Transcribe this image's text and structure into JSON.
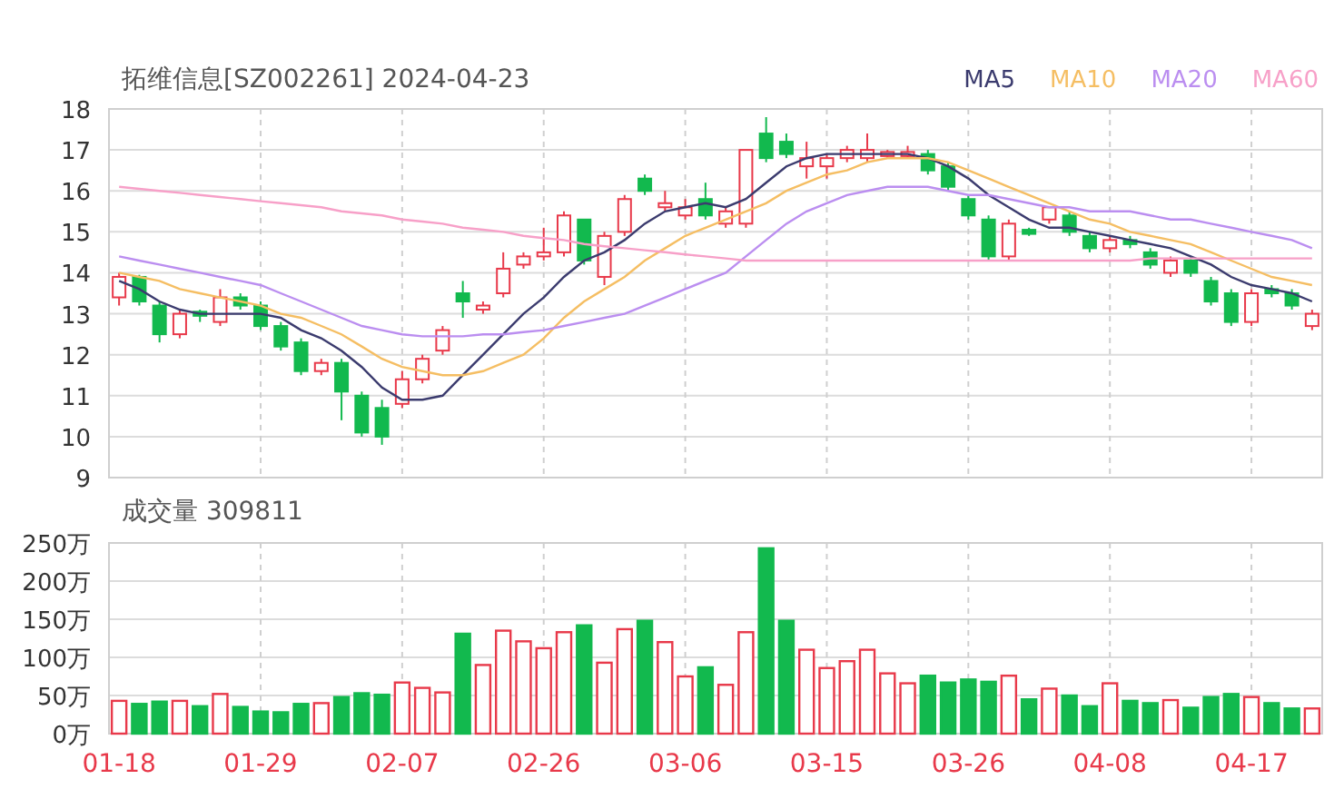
{
  "price": {
    "chart_data": {
      "type": "candlestick",
      "title": "拓维信息[SZ002261] 2024-04-23",
      "grid": true,
      "ylim": [
        9,
        18
      ],
      "yticks": [
        9,
        10,
        11,
        12,
        13,
        14,
        15,
        16,
        17,
        18
      ],
      "ohlc": [
        [
          13.4,
          14.0,
          13.2,
          13.9
        ],
        [
          13.9,
          13.95,
          13.2,
          13.3
        ],
        [
          13.2,
          13.3,
          12.3,
          12.5
        ],
        [
          12.5,
          13.1,
          12.4,
          13.0
        ],
        [
          13.05,
          13.1,
          12.8,
          12.95
        ],
        [
          12.8,
          13.6,
          12.7,
          13.4
        ],
        [
          13.4,
          13.5,
          13.1,
          13.2
        ],
        [
          13.2,
          13.3,
          12.6,
          12.7
        ],
        [
          12.7,
          12.8,
          12.1,
          12.2
        ],
        [
          12.3,
          12.4,
          11.5,
          11.6
        ],
        [
          11.6,
          11.9,
          11.5,
          11.8
        ],
        [
          11.8,
          11.9,
          10.4,
          11.1
        ],
        [
          11.0,
          11.1,
          10.0,
          10.1
        ],
        [
          10.7,
          10.9,
          9.8,
          10.0
        ],
        [
          10.8,
          11.6,
          10.7,
          11.4
        ],
        [
          11.4,
          12.0,
          11.3,
          11.9
        ],
        [
          12.1,
          12.7,
          12.0,
          12.6
        ],
        [
          13.5,
          13.8,
          12.9,
          13.3
        ],
        [
          13.1,
          13.3,
          13.0,
          13.2
        ],
        [
          13.5,
          14.5,
          13.4,
          14.1
        ],
        [
          14.2,
          14.5,
          14.1,
          14.4
        ],
        [
          14.4,
          15.1,
          14.3,
          14.5
        ],
        [
          14.5,
          15.5,
          14.4,
          15.4
        ],
        [
          15.3,
          15.3,
          14.2,
          14.3
        ],
        [
          13.9,
          15.0,
          13.7,
          14.9
        ],
        [
          15.0,
          15.9,
          14.9,
          15.8
        ],
        [
          16.3,
          16.4,
          15.9,
          16.0
        ],
        [
          15.6,
          16.0,
          15.5,
          15.7
        ],
        [
          15.4,
          15.8,
          15.3,
          15.6
        ],
        [
          15.8,
          16.2,
          15.3,
          15.4
        ],
        [
          15.2,
          15.6,
          15.1,
          15.5
        ],
        [
          15.2,
          17.0,
          15.1,
          17.0
        ],
        [
          17.4,
          17.8,
          16.7,
          16.8
        ],
        [
          17.2,
          17.4,
          16.8,
          16.9
        ],
        [
          16.6,
          17.2,
          16.3,
          16.8
        ],
        [
          16.6,
          16.9,
          16.3,
          16.8
        ],
        [
          16.8,
          17.1,
          16.7,
          17.0
        ],
        [
          16.8,
          17.4,
          16.7,
          17.0
        ],
        [
          16.85,
          17.0,
          16.8,
          16.95
        ],
        [
          16.85,
          17.1,
          16.8,
          16.95
        ],
        [
          16.9,
          17.0,
          16.4,
          16.5
        ],
        [
          16.6,
          16.7,
          16.0,
          16.1
        ],
        [
          15.8,
          15.9,
          15.3,
          15.4
        ],
        [
          15.3,
          15.4,
          14.3,
          14.4
        ],
        [
          14.4,
          15.3,
          14.3,
          15.2
        ],
        [
          15.05,
          15.1,
          14.9,
          14.95
        ],
        [
          15.3,
          15.6,
          15.2,
          15.6
        ],
        [
          15.4,
          15.5,
          14.9,
          15.0
        ],
        [
          14.9,
          15.0,
          14.5,
          14.6
        ],
        [
          14.6,
          14.9,
          14.5,
          14.8
        ],
        [
          14.8,
          14.9,
          14.6,
          14.7
        ],
        [
          14.5,
          14.6,
          14.1,
          14.2
        ],
        [
          14.0,
          14.4,
          13.9,
          14.3
        ],
        [
          14.3,
          14.4,
          13.9,
          14.0
        ],
        [
          13.8,
          13.9,
          13.2,
          13.3
        ],
        [
          13.5,
          13.6,
          12.7,
          12.8
        ],
        [
          12.8,
          13.6,
          12.7,
          13.5
        ],
        [
          13.6,
          13.7,
          13.4,
          13.5
        ],
        [
          13.5,
          13.6,
          13.1,
          13.2
        ],
        [
          12.7,
          13.1,
          12.6,
          13.0
        ]
      ]
    }
  },
  "moving_averages": {
    "chart_data": {
      "type": "line",
      "ylim": [
        9,
        18
      ],
      "series": [
        {
          "name": "MA5",
          "color": "#3b3b6e",
          "values": [
            13.8,
            13.6,
            13.3,
            13.1,
            13.0,
            13.0,
            13.0,
            13.0,
            12.9,
            12.6,
            12.4,
            12.1,
            11.7,
            11.2,
            10.9,
            10.9,
            11.0,
            11.5,
            12.0,
            12.5,
            13.0,
            13.4,
            13.9,
            14.3,
            14.5,
            14.8,
            15.2,
            15.5,
            15.6,
            15.7,
            15.6,
            15.8,
            16.2,
            16.6,
            16.8,
            16.9,
            16.9,
            16.9,
            16.9,
            16.9,
            16.8,
            16.6,
            16.3,
            15.9,
            15.6,
            15.3,
            15.1,
            15.1,
            15.0,
            14.9,
            14.8,
            14.7,
            14.6,
            14.4,
            14.2,
            13.9,
            13.7,
            13.6,
            13.5,
            13.3
          ]
        },
        {
          "name": "MA10",
          "color": "#f5be63",
          "values": [
            14.0,
            13.9,
            13.8,
            13.6,
            13.5,
            13.4,
            13.3,
            13.2,
            13.0,
            12.9,
            12.7,
            12.5,
            12.2,
            11.9,
            11.7,
            11.6,
            11.5,
            11.5,
            11.6,
            11.8,
            12.0,
            12.4,
            12.9,
            13.3,
            13.6,
            13.9,
            14.3,
            14.6,
            14.9,
            15.1,
            15.3,
            15.5,
            15.7,
            16.0,
            16.2,
            16.4,
            16.5,
            16.7,
            16.8,
            16.8,
            16.8,
            16.7,
            16.5,
            16.3,
            16.1,
            15.9,
            15.7,
            15.5,
            15.3,
            15.2,
            15.0,
            14.9,
            14.8,
            14.7,
            14.5,
            14.3,
            14.1,
            13.9,
            13.8,
            13.7
          ]
        },
        {
          "name": "MA20",
          "color": "#bb8ef0",
          "values": [
            14.4,
            14.3,
            14.2,
            14.1,
            14.0,
            13.9,
            13.8,
            13.7,
            13.5,
            13.3,
            13.1,
            12.9,
            12.7,
            12.6,
            12.5,
            12.45,
            12.45,
            12.45,
            12.5,
            12.5,
            12.55,
            12.6,
            12.7,
            12.8,
            12.9,
            13.0,
            13.2,
            13.4,
            13.6,
            13.8,
            14.0,
            14.4,
            14.8,
            15.2,
            15.5,
            15.7,
            15.9,
            16.0,
            16.1,
            16.1,
            16.1,
            16.0,
            15.9,
            15.9,
            15.8,
            15.7,
            15.6,
            15.6,
            15.5,
            15.5,
            15.5,
            15.4,
            15.3,
            15.3,
            15.2,
            15.1,
            15.0,
            14.9,
            14.8,
            14.6
          ]
        },
        {
          "name": "MA60",
          "color": "#f7a0c8",
          "values": [
            16.1,
            16.05,
            16.0,
            15.95,
            15.9,
            15.85,
            15.8,
            15.75,
            15.7,
            15.65,
            15.6,
            15.5,
            15.45,
            15.4,
            15.3,
            15.25,
            15.2,
            15.1,
            15.05,
            15.0,
            14.9,
            14.85,
            14.8,
            14.7,
            14.65,
            14.6,
            14.55,
            14.5,
            14.45,
            14.4,
            14.35,
            14.3,
            14.3,
            14.3,
            14.3,
            14.3,
            14.3,
            14.3,
            14.3,
            14.3,
            14.3,
            14.3,
            14.3,
            14.3,
            14.3,
            14.3,
            14.3,
            14.3,
            14.3,
            14.3,
            14.3,
            14.35,
            14.35,
            14.35,
            14.35,
            14.35,
            14.35,
            14.35,
            14.35,
            14.35
          ]
        }
      ]
    }
  },
  "volume": {
    "chart_data": {
      "type": "bar",
      "title": "成交量 309811",
      "grid": true,
      "ylim": [
        0,
        250
      ],
      "yticks": [
        {
          "value": 0,
          "label": "0万"
        },
        {
          "value": 50,
          "label": "50万"
        },
        {
          "value": 100,
          "label": "100万"
        },
        {
          "value": 150,
          "label": "150万"
        },
        {
          "value": 200,
          "label": "200万"
        },
        {
          "value": 250,
          "label": "250万"
        }
      ],
      "categories": [
        "01-18",
        null,
        null,
        null,
        null,
        null,
        null,
        "01-29",
        null,
        null,
        null,
        null,
        null,
        null,
        "02-07",
        null,
        null,
        null,
        null,
        null,
        null,
        "02-26",
        null,
        null,
        null,
        null,
        null,
        null,
        "03-06",
        null,
        null,
        null,
        null,
        null,
        null,
        "03-15",
        null,
        null,
        null,
        null,
        null,
        null,
        "03-26",
        null,
        null,
        null,
        null,
        null,
        null,
        "04-08",
        null,
        null,
        null,
        null,
        null,
        null,
        "04-17",
        null,
        null,
        null
      ],
      "values": [
        43,
        39,
        42,
        43,
        36,
        52,
        35,
        29,
        28,
        39,
        40,
        48,
        53,
        51,
        67,
        60,
        54,
        131,
        90,
        135,
        121,
        112,
        133,
        142,
        93,
        137,
        148,
        120,
        75,
        87,
        64,
        133,
        243,
        148,
        110,
        86,
        95,
        110,
        79,
        66,
        76,
        67,
        71,
        68,
        76,
        45,
        59,
        50,
        36,
        66,
        43,
        40,
        44,
        34,
        48,
        52,
        48,
        40,
        33,
        33
      ]
    }
  }
}
